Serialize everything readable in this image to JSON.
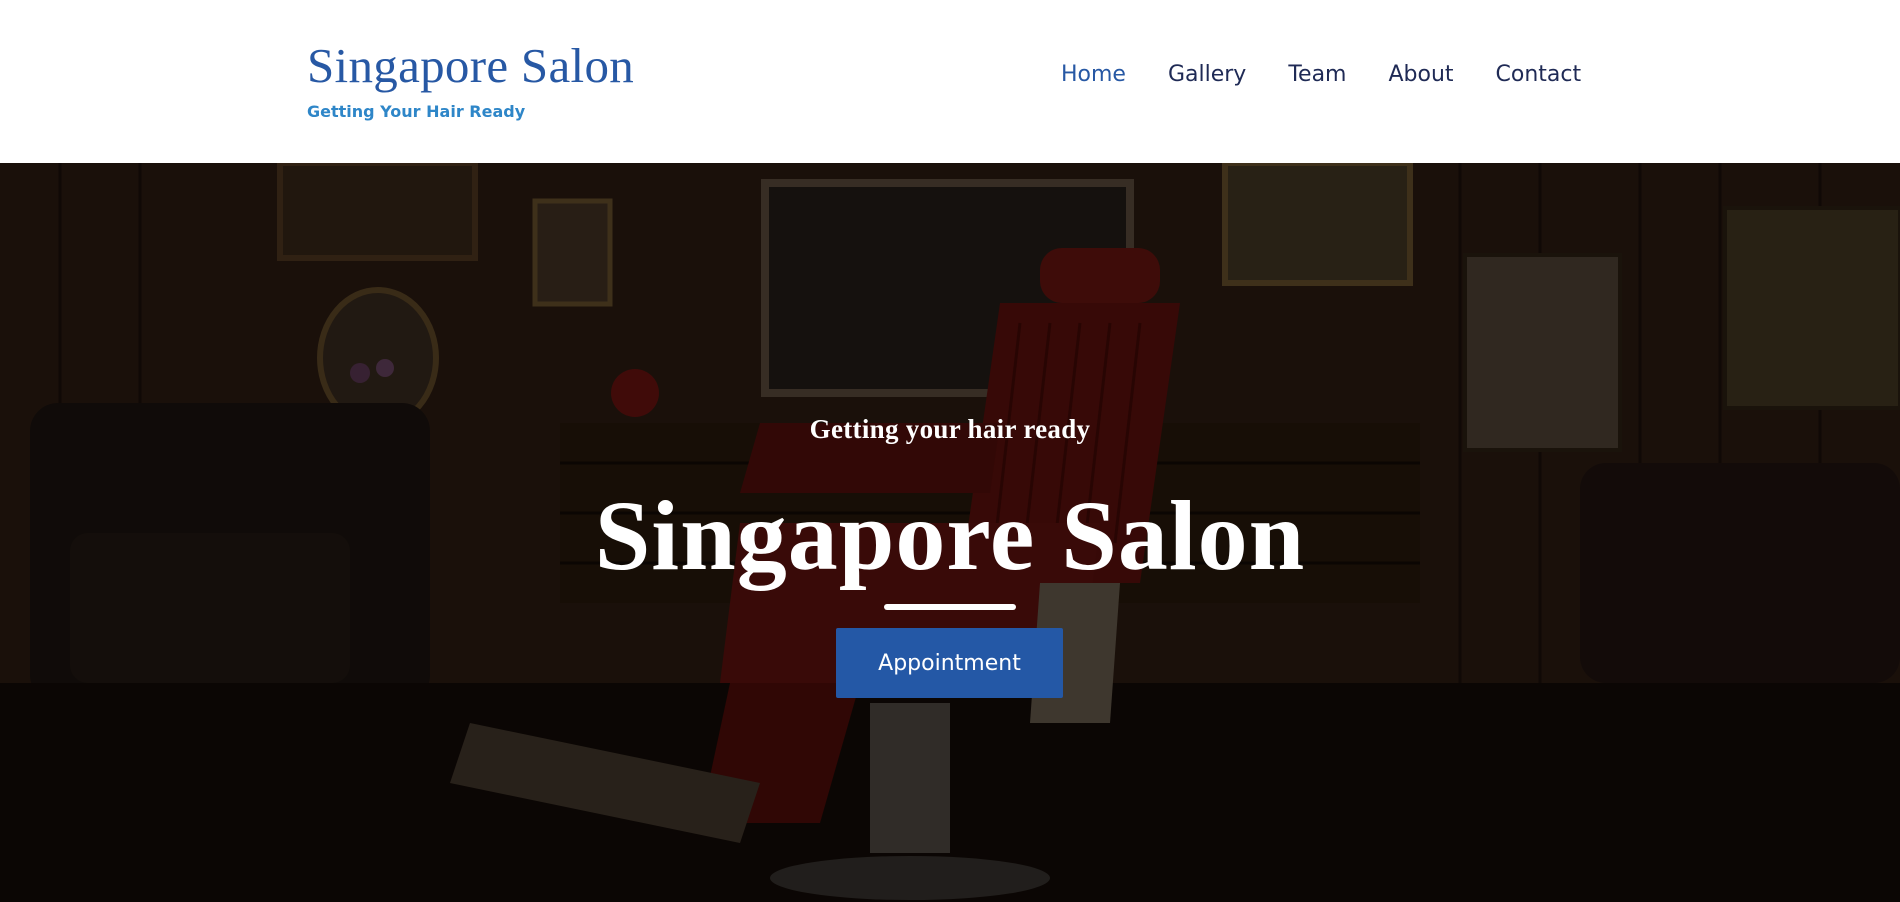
{
  "brand": {
    "title": "Singapore Salon",
    "tagline": "Getting Your Hair Ready"
  },
  "nav": {
    "items": [
      {
        "label": "Home",
        "active": true
      },
      {
        "label": "Gallery",
        "active": false
      },
      {
        "label": "Team",
        "active": false
      },
      {
        "label": "About",
        "active": false
      },
      {
        "label": "Contact",
        "active": false
      }
    ]
  },
  "hero": {
    "kicker": "Getting your hair ready",
    "title": "Singapore Salon",
    "button_label": "Appointment"
  },
  "colors": {
    "brand_blue": "#2758a4",
    "tagline_blue": "#2e86c8",
    "nav_text": "#1f2a55",
    "button_bg": "#2458a6",
    "chair_red": "#7a1410"
  }
}
